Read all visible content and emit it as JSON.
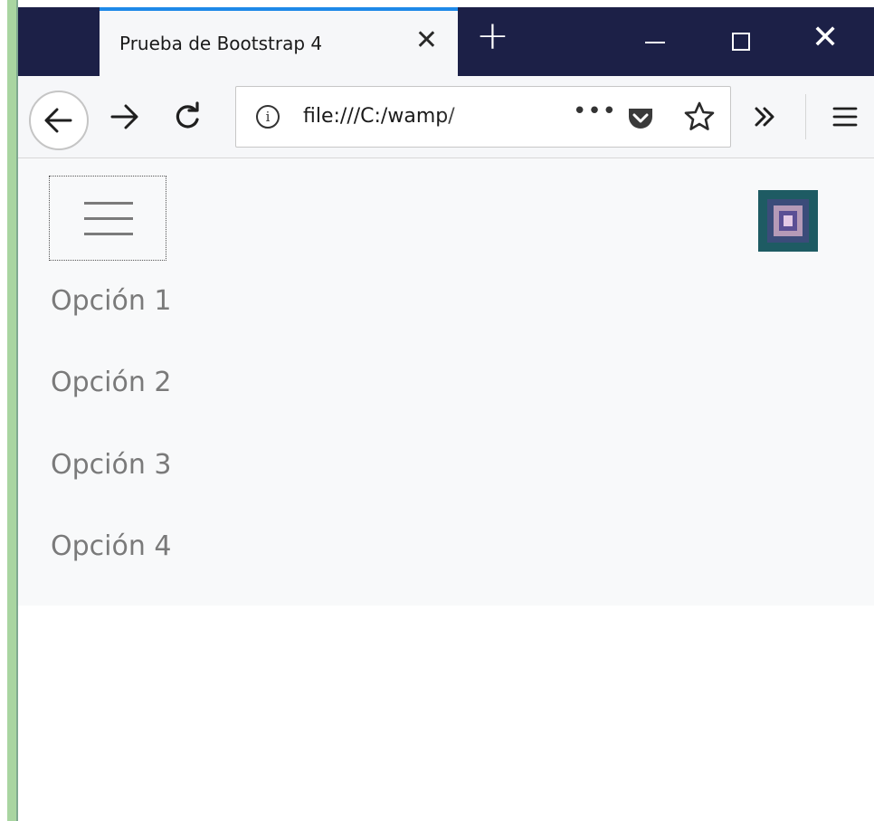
{
  "browser": {
    "tab_title": "Prueba de Bootstrap 4",
    "tab_close_glyph": "✕",
    "new_tab_glyph": "+",
    "address": "file:///C:/wamp/",
    "page_actions_glyph": "•••",
    "window_close_glyph": "✕"
  },
  "icons": {
    "back": "back-arrow-icon",
    "forward": "forward-arrow-icon",
    "reload": "reload-icon",
    "info": "info-icon",
    "pocket": "pocket-icon",
    "bookmark": "star-icon",
    "overflow": "double-chevron-icon",
    "menu": "hamburger-menu-icon"
  },
  "page": {
    "menu_items": [
      "Opción 1",
      "Opción 2",
      "Opción 3",
      "Opción 4"
    ]
  },
  "colors": {
    "tabbar": "#1c2047",
    "active_tab_accent": "#1e89e8",
    "navbar_bg": "#f8f9fa",
    "menu_text": "#7a7a7a"
  }
}
